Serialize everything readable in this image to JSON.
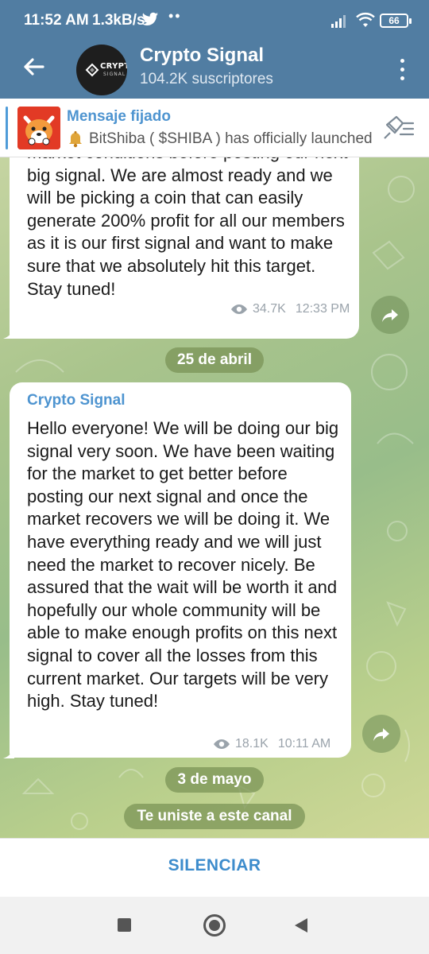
{
  "status_bar": {
    "time": "11:52 AM",
    "net_speed": "1.3kB/s",
    "twitter_icon": "twitter-bird-icon",
    "dots": "••",
    "battery": "66"
  },
  "header": {
    "title": "Crypto Signal",
    "subscribers": "104.2K suscriptores",
    "avatar": {
      "line1": "CRYPTO",
      "line2": "SIGNAL"
    }
  },
  "pinned": {
    "title": "Mensaje fijado",
    "text": "BitShiba ( $SHIBA ) has officially launched"
  },
  "messages": [
    {
      "text": "market conditions before posting our next big signal. We are almost ready and we will be picking a coin that can easily generate 200% profit for all our members as it is our first signal and want to make sure that we absolutely hit this target. Stay tuned!",
      "views": "34.7K",
      "time": "12:33 PM"
    },
    {
      "sender": "Crypto Signal",
      "text": "Hello everyone! We will be doing our big signal very soon. We have been waiting for the market to get better before posting our next signal and once the market recovers we will be doing it. We have everything ready and we will just need the market to recover nicely. Be assured that the wait will be worth it and hopefully our whole community will be able to make enough profits on this next signal to cover all the losses from this current market. Our targets will be very high. Stay tuned!",
      "views": "18.1K",
      "time": "10:11 AM"
    }
  ],
  "dates": {
    "first": "25 de abril",
    "second": "3 de mayo"
  },
  "service_message": "Te uniste a este canal",
  "bottom": {
    "mute_label": "SILENCIAR"
  },
  "colors": {
    "header": "#517da2",
    "accent": "#4e94d0",
    "pill": "#789155",
    "mute": "#3d8ccc"
  }
}
